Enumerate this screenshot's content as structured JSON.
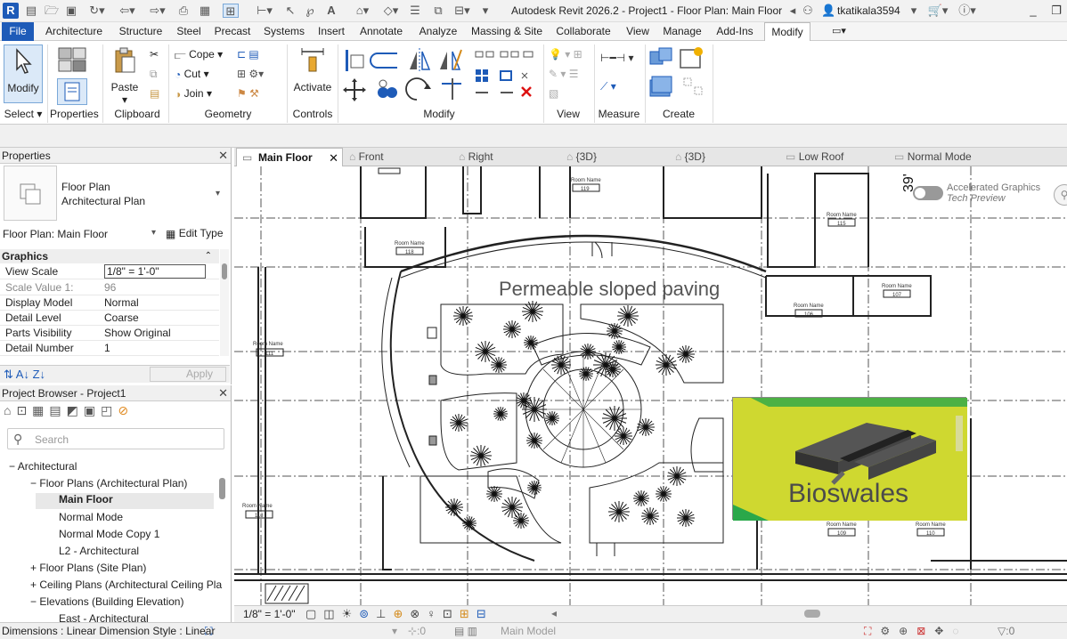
{
  "app": {
    "icon_letter": "R",
    "title": "Autodesk Revit 2026.2 - Project1 - Floor Plan: Main Floor",
    "user": "tkatikala3594"
  },
  "ribbon_tabs": [
    "File",
    "Architecture",
    "Structure",
    "Steel",
    "Precast",
    "Systems",
    "Insert",
    "Annotate",
    "Analyze",
    "Massing & Site",
    "Collaborate",
    "View",
    "Manage",
    "Add-Ins",
    "Modify"
  ],
  "ribbon": {
    "modify_label": "Modify",
    "paste_label": "Paste",
    "cope_label": "Cope",
    "cut_label": "Cut",
    "join_label": "Join",
    "activate_label": "Activate",
    "groups": [
      "Select",
      "Properties",
      "Clipboard",
      "Geometry",
      "Controls",
      "Modify",
      "View",
      "Measure",
      "Create"
    ]
  },
  "properties": {
    "title": "Properties",
    "type_line1": "Floor Plan",
    "type_line2": "Architectural Plan",
    "instance": "Floor Plan: Main Floor",
    "edit_type": "Edit Type",
    "section": "Graphics",
    "rows": [
      {
        "k": "View Scale",
        "v": "1/8\" = 1'-0\""
      },
      {
        "k": "Scale Value    1:",
        "v": "96"
      },
      {
        "k": "Display Model",
        "v": "Normal"
      },
      {
        "k": "Detail Level",
        "v": "Coarse"
      },
      {
        "k": "Parts Visibility",
        "v": "Show Original"
      },
      {
        "k": "Detail Number",
        "v": "1"
      }
    ],
    "apply": "Apply"
  },
  "browser": {
    "title": "Project Browser - Project1",
    "search_placeholder": "Search",
    "items": [
      {
        "label": "Architectural",
        "sign": "−"
      },
      {
        "label": "Floor Plans (Architectural Plan)",
        "sign": "−"
      },
      {
        "label": "Main Floor",
        "sign": ""
      },
      {
        "label": "Normal Mode",
        "sign": ""
      },
      {
        "label": "Normal Mode Copy 1",
        "sign": ""
      },
      {
        "label": "L2 - Architectural",
        "sign": ""
      },
      {
        "label": "Floor Plans (Site Plan)",
        "sign": "+"
      },
      {
        "label": "Ceiling Plans (Architectural Ceiling Pla",
        "sign": "+"
      },
      {
        "label": "Elevations (Building Elevation)",
        "sign": "−"
      },
      {
        "label": "East - Architectural",
        "sign": ""
      }
    ]
  },
  "view_tabs": [
    "Main Floor",
    "Front",
    "Right",
    "{3D}",
    "{3D}",
    "Low Roof",
    "Normal Mode"
  ],
  "canvas": {
    "overlay_title": "Permeable sloped paving",
    "bioswale_title": "Bioswales",
    "room_name": "Room Name",
    "rooms": [
      "119",
      "115",
      "118",
      "107",
      "106",
      "111",
      "113",
      "109",
      "110"
    ],
    "accel_line1": "Accelerated Graphics",
    "accel_line2": "Tech Preview",
    "dim_text": "39'"
  },
  "viewbar": {
    "scale": "1/8\" = 1'-0\""
  },
  "status": {
    "text": "Dimensions : Linear Dimension Style : Linear",
    "selection": ":0",
    "model": "Main Model",
    "filter": ":0"
  }
}
